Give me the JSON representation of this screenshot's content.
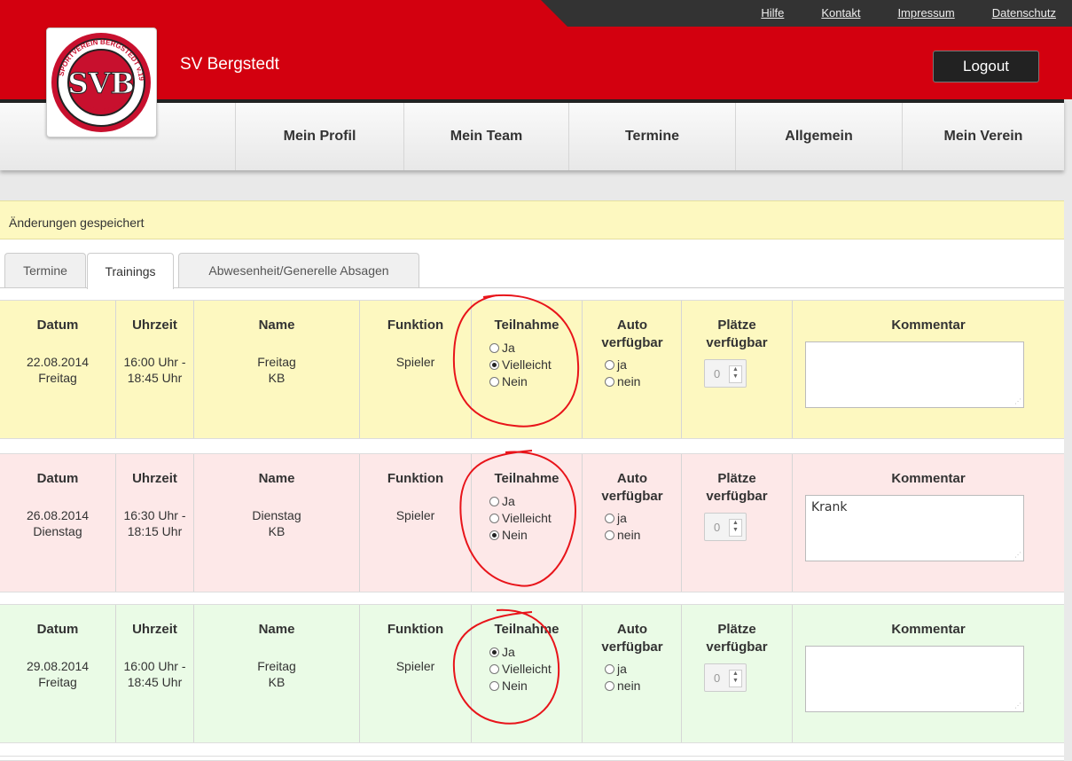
{
  "header": {
    "club_name": "SV Bergstedt",
    "logout_label": "Logout",
    "top_links": [
      "Hilfe",
      "Kontakt",
      "Impressum",
      "Datenschutz"
    ],
    "logo": {
      "ring_text_top": "SPORTVEREIN BERGSTEDT v.1948",
      "ring_text_bottom": "HAMBURG",
      "monogram": "SVB"
    }
  },
  "nav": [
    "Mein Profil",
    "Mein Team",
    "Termine",
    "Allgemein",
    "Mein Verein"
  ],
  "notice": "Änderungen gespeichert",
  "tabs": [
    "Termine",
    "Trainings",
    "Abwesenheit/Generelle Absagen"
  ],
  "headers": {
    "datum": "Datum",
    "uhrzeit": "Uhrzeit",
    "name": "Name",
    "funktion": "Funktion",
    "teilnahme": "Teilnahme",
    "auto": "Auto verfügbar",
    "plaetze": "Plätze verfügbar",
    "kommentar": "Kommentar"
  },
  "teilnahme_options": [
    "Ja",
    "Vielleicht",
    "Nein"
  ],
  "auto_options": [
    "ja",
    "nein"
  ],
  "rows": [
    {
      "bg": "#fdf8c0",
      "date": "22.08.2014",
      "weekday": "Freitag",
      "time_from": "16:00 Uhr -",
      "time_to": "18:45 Uhr",
      "name_line1": "Freitag",
      "name_line2": "KB",
      "funktion": "Spieler",
      "teilnahme": "Vielleicht",
      "plaetze": "0",
      "kommentar": ""
    },
    {
      "bg": "#fde8e8",
      "date": "26.08.2014",
      "weekday": "Dienstag",
      "time_from": "16:30 Uhr -",
      "time_to": "18:15 Uhr",
      "name_line1": "Dienstag",
      "name_line2": "KB",
      "funktion": "Spieler",
      "teilnahme": "Nein",
      "plaetze": "0",
      "kommentar": "Krank"
    },
    {
      "bg": "#eafbe6",
      "date": "29.08.2014",
      "weekday": "Freitag",
      "time_from": "16:00 Uhr -",
      "time_to": "18:45 Uhr",
      "name_line1": "Freitag",
      "name_line2": "KB",
      "funktion": "Spieler",
      "teilnahme": "Ja",
      "plaetze": "0",
      "kommentar": ""
    }
  ]
}
